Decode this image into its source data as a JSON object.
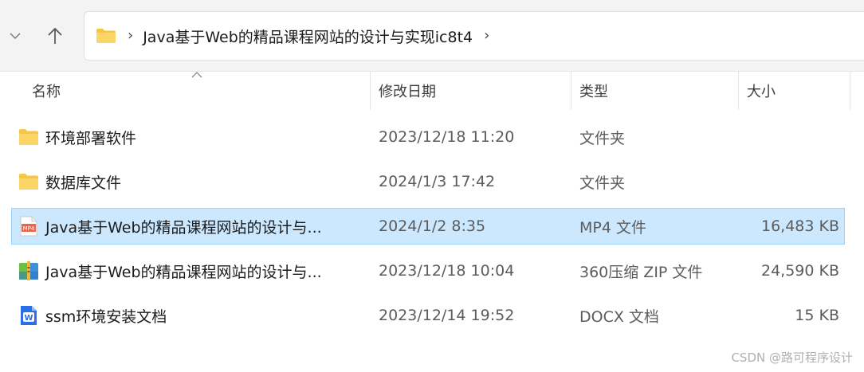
{
  "address": {
    "path": "Java基于Web的精品课程网站的设计与实现ic8t4",
    "separator": "›",
    "trailing_separator": "›"
  },
  "columns": {
    "name": "名称",
    "modified": "修改日期",
    "type": "类型",
    "size": "大小"
  },
  "files": [
    {
      "icon": "folder-icon",
      "name": "环境部署软件",
      "modified": "2023/12/18 11:20",
      "type": "文件夹",
      "size": ""
    },
    {
      "icon": "folder-icon",
      "name": "数据库文件",
      "modified": "2024/1/3 17:42",
      "type": "文件夹",
      "size": ""
    },
    {
      "icon": "mp4-file-icon",
      "name": "Java基于Web的精品课程网站的设计与...",
      "modified": "2024/1/2 8:35",
      "type": "MP4 文件",
      "size": "16,483 KB",
      "selected": true
    },
    {
      "icon": "zip-archive-icon",
      "name": "Java基于Web的精品课程网站的设计与...",
      "modified": "2023/12/18 10:04",
      "type": "360压缩 ZIP 文件",
      "size": "24,590 KB"
    },
    {
      "icon": "docx-file-icon",
      "name": "ssm环境安装文档",
      "modified": "2023/12/14 19:52",
      "type": "DOCX 文档",
      "size": "15 KB"
    }
  ],
  "icons": {
    "mp4_label": "MP4",
    "docx_label": "W"
  },
  "colors": {
    "folder": "#f8c646",
    "selection": "#cce8ff",
    "selection_border": "#99d1ff",
    "mp4": "#e8674f",
    "docx": "#2a6ee8"
  },
  "watermark": "CSDN @路可程序设计"
}
